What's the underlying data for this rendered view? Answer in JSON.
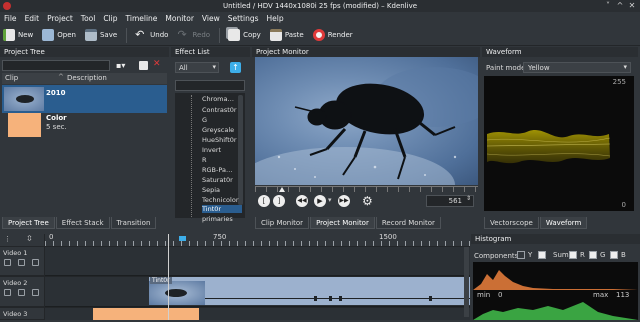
{
  "window": {
    "title": "Untitled / HDV 1440x1080i 25 fps (modified) – Kdenlive",
    "controls": [
      "˅",
      "^",
      "✕"
    ]
  },
  "menu": [
    "File",
    "Edit",
    "Project",
    "Tool",
    "Clip",
    "Timeline",
    "Monitor",
    "View",
    "Settings",
    "Help"
  ],
  "toolbar": [
    {
      "label": "New",
      "icon": "new-document-icon",
      "color": "#e8e8e8"
    },
    {
      "label": "Open",
      "icon": "open-folder-icon",
      "color": "#9cb8d6"
    },
    {
      "label": "Save",
      "icon": "save-icon",
      "color": "#aebcc8"
    },
    {
      "label": "Undo",
      "icon": "undo-icon",
      "color": "#f4f4f4"
    },
    {
      "label": "Redo",
      "icon": "redo-icon",
      "color": "#6a6f74",
      "disabled": true
    },
    {
      "label": "Copy",
      "icon": "copy-icon",
      "color": "#e8e8e8"
    },
    {
      "label": "Paste",
      "icon": "paste-icon",
      "color": "#e8e8e8"
    },
    {
      "label": "Render",
      "icon": "render-icon",
      "color": "#e03a3a"
    }
  ],
  "project_tree": {
    "title": "Project Tree",
    "columns": [
      "Clip",
      "Description"
    ],
    "clips": [
      {
        "name": "2010",
        "duration": "",
        "thumb": "video"
      },
      {
        "name": "Color",
        "duration": "5 sec.",
        "thumb": "color"
      }
    ],
    "tabs": [
      "Project Tree",
      "Effect Stack",
      "Transition"
    ]
  },
  "effect_list": {
    "title": "Effect List",
    "filter": "All",
    "items": [
      "Chroma…",
      "Contrast0r",
      "G",
      "Greyscale",
      "HueShift0r",
      "Invert",
      "R",
      "RGB-Pa…",
      "Saturat0r",
      "Sepia",
      "Technicolor",
      "Tint0r",
      "primaries"
    ],
    "selected_index": 11
  },
  "project_monitor": {
    "title": "Project Monitor",
    "timecode": "561",
    "tabs": [
      "Clip Monitor",
      "Project Monitor",
      "Record Monitor"
    ],
    "selected_tab": 1
  },
  "waveform": {
    "title": "Waveform",
    "paint_mode_label": "Paint mode",
    "paint_mode": "Yellow",
    "scale_top": "255",
    "scale_bottom": "0",
    "tabs": [
      "Vectorscope",
      "Waveform"
    ],
    "selected_tab": 1
  },
  "timeline": {
    "ruler": [
      "0",
      "750",
      "1500"
    ],
    "tracks": [
      {
        "label": "Video 1"
      },
      {
        "label": "Video 2",
        "clip_label": "Tint0r"
      },
      {
        "label": "Video 3"
      }
    ]
  },
  "histogram": {
    "title": "Histogram",
    "components_label": "Components",
    "checks": [
      {
        "label": "Y",
        "checked": false
      },
      {
        "label": "Sum",
        "checked": true
      },
      {
        "label": "R",
        "checked": true
      },
      {
        "label": "G",
        "checked": true
      },
      {
        "label": "B",
        "checked": true
      }
    ],
    "min_label": "min",
    "min_value": "0",
    "max_label": "max",
    "max_value": "113"
  }
}
